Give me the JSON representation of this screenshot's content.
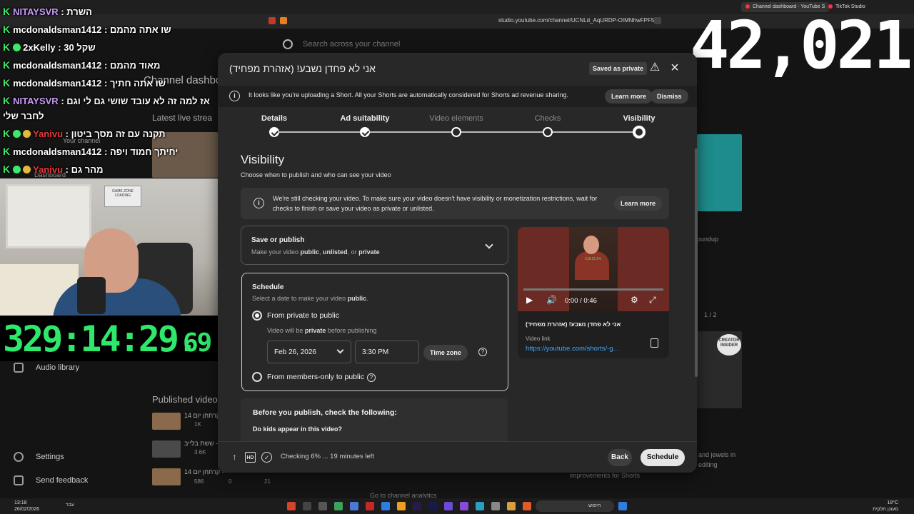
{
  "browser": {
    "tabs": [
      {
        "label": "Channel dashboard - YouTube S",
        "active": true,
        "color": "#ff3333"
      },
      {
        "label": "TikTok Studio",
        "active": false,
        "color": "#ff2d55"
      }
    ],
    "url": "studio.youtube.com/channel/UCNLd_AqURDP-OIMNhwFPF5A"
  },
  "studio": {
    "search_placeholder": "Search across your channel",
    "channel_dashboard": "Channel dashboard",
    "latest_live": "Latest live strea",
    "your_channel": "Your channel",
    "dashboard": "Dashboard",
    "audio_library": "Audio library",
    "settings": "Settings",
    "send_feedback": "Send feedback",
    "published_videos": "Published videos",
    "right_snippets": {
      "roundup": "oundup",
      "pager": "1 / 2",
      "creator_insider": "CREATOR INSIDER",
      "improvements": "improvements for Shorts",
      "jewels": "and jewels in",
      "editing": "editing",
      "go_analytics": "Go to channel analytics"
    },
    "published_rows": [
      {
        "title": "14 קרתחן יום -",
        "views": "1K"
      },
      {
        "title": "ששת בלייב -",
        "views": "3.6K"
      },
      {
        "title": "14 קרתחן יום -",
        "views": "586",
        "comments": "0",
        "likes": "21"
      }
    ]
  },
  "stream_overlay": {
    "counter": "42,021",
    "timer_main": "329:14:29.",
    "timer_ms": "69",
    "chat": [
      {
        "user": "NITAYSVR",
        "user_color": "purple",
        "text": "השרת"
      },
      {
        "user": "mcdonaldsman1412",
        "user_color": "white",
        "text": "שו אתה מהמם"
      },
      {
        "user": "2xKelly",
        "user_color": "white",
        "text": "שקל 30"
      },
      {
        "user": "mcdonaldsman1412",
        "user_color": "white",
        "text": "מאוד מהמם"
      },
      {
        "user": "mcdonaldsman1412",
        "user_color": "white",
        "text": "שו אתה חתיך"
      },
      {
        "user": "NITAYSVR",
        "user_color": "purple",
        "text": "אז למה זה לא עובד שושי גם לי וגם"
      },
      {
        "user": "",
        "user_color": "white",
        "text": "לחבר שלי"
      },
      {
        "user": "Yanivu",
        "user_color": "red",
        "text": "תקנה עם זה מסך ביטון"
      },
      {
        "user": "mcdonaldsman1412",
        "user_color": "white",
        "text": "יחיתך חמוד ויפה"
      },
      {
        "user": "Yanivu",
        "user_color": "red",
        "text": "מהר גם"
      }
    ],
    "webcam_board": "GAME ZONE LOADING"
  },
  "modal": {
    "title": "אני לא פחדן נשבע! (אזהרת מפחיד)",
    "saved_chip": "Saved as private",
    "banner": {
      "text": "It looks like you're uploading a Short. All your Shorts are automatically considered for Shorts ad revenue sharing.",
      "learn_more": "Learn more",
      "dismiss": "Dismiss"
    },
    "steps": [
      {
        "label": "Details",
        "state": "done"
      },
      {
        "label": "Ad suitability",
        "state": "done"
      },
      {
        "label": "Video elements",
        "state": "pending"
      },
      {
        "label": "Checks",
        "state": "pending"
      },
      {
        "label": "Visibility",
        "state": "current"
      }
    ],
    "visibility_title": "Visibility",
    "visibility_sub": "Choose when to publish and who can see your video",
    "checking_notice": "We're still checking your video. To make sure your video doesn't have visibility or monetization restrictions, wait for checks to finish or save your video as private or unlisted.",
    "checking_learn_more": "Learn more",
    "save_or_publish": {
      "title": "Save or publish",
      "sub_prefix": "Make your video ",
      "opt1": "public",
      "sep1": ", ",
      "opt2": "unlisted",
      "sep2": ", or ",
      "opt3": "private"
    },
    "schedule": {
      "title": "Schedule",
      "sub_prefix": "Select a date to make your video ",
      "sub_bold": "public",
      "sub_suffix": ".",
      "option1": "From private to public",
      "option1_note_prefix": "Video will be ",
      "option1_note_bold": "private",
      "option1_note_suffix": " before publishing",
      "date": "Feb 26, 2026",
      "time": "3:30 PM",
      "time_zone": "Time zone",
      "option2": "From members-only to public",
      "selected": "option1"
    },
    "preview": {
      "time": "0:00 / 0:46",
      "overlay_time": "218:01:54.",
      "video_title": "אני לא פחדן נשבע! (אזהרת מפחיד)",
      "video_link_label": "Video link",
      "video_link": "https://youtube.com/shorts/-g..."
    },
    "before_publish": {
      "title": "Before you publish, check the following:",
      "q1": "Do kids appear in this video?"
    },
    "footer": {
      "status": "Checking 6% ... 19 minutes left",
      "back": "Back",
      "schedule": "Schedule"
    }
  },
  "taskbar": {
    "time_left": "13:18",
    "date_left": "26/02/2026",
    "lang": "עבר",
    "search": "חיפוש",
    "weather": "18°C",
    "weather_sub": "מעונן חלקית"
  }
}
